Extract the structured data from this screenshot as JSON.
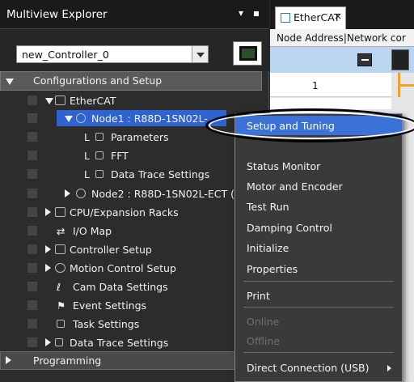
{
  "explorer": {
    "title": "Multiview Explorer",
    "pin_glyphs": "▾ ᵖ",
    "controller_select": "new_Controller_0"
  },
  "tree": {
    "configurations": "Configurations and Setup",
    "ethercat": "EtherCAT",
    "node1": "Node1 : R88D-1SN02L-",
    "parameters": "Parameters",
    "fft": "FFT",
    "data_trace_child": "Data Trace Settings",
    "node2": "Node2 : R88D-1SN02L-ECT (",
    "cpu_racks": "CPU/Expansion Racks",
    "io_map": "I/O Map",
    "controller_setup": "Controller Setup",
    "motion_control": "Motion Control Setup",
    "cam_data": "Cam Data Settings",
    "event_settings": "Event Settings",
    "task_settings": "Task Settings",
    "data_trace": "Data Trace Settings",
    "programming": "Programming"
  },
  "editor": {
    "tab_label": "EtherCAT",
    "tab_close": "×",
    "header": "Node Address|Network cor",
    "row1_value": "1"
  },
  "context_menu": {
    "items": [
      {
        "label": "Setup and Tuning",
        "state": "highlight"
      },
      {
        "label": "Status Monitor",
        "state": "normal"
      },
      {
        "label": "Motor and Encoder",
        "state": "normal"
      },
      {
        "label": "Test Run",
        "state": "normal"
      },
      {
        "label": "Damping Control",
        "state": "normal"
      },
      {
        "label": "Initialize",
        "state": "normal"
      },
      {
        "label": "Properties",
        "state": "normal"
      },
      {
        "label": "Print",
        "state": "normal"
      },
      {
        "label": "Online",
        "state": "disabled"
      },
      {
        "label": "Offline",
        "state": "disabled"
      },
      {
        "label": "Direct Connection (USB)",
        "state": "normal"
      }
    ]
  },
  "colors": {
    "highlight": "#3b72d8",
    "selected_node": "#2f63d0",
    "menu_bg": "#3a3a3a",
    "disabled_text": "#6f6f6f",
    "orange_link": "#f0a030"
  }
}
